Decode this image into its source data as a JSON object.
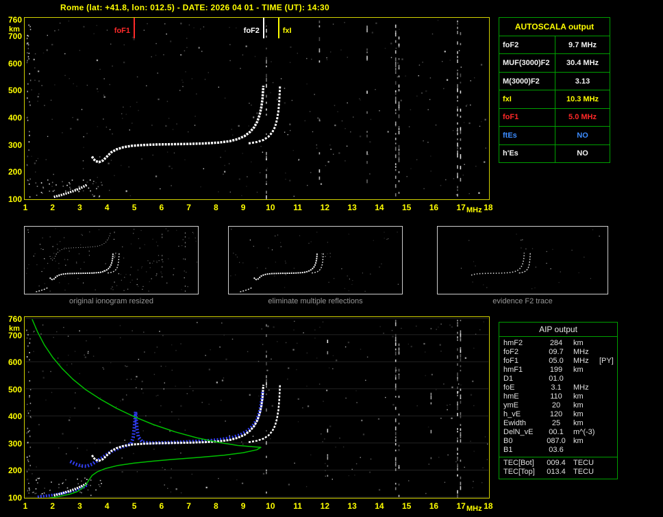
{
  "title": "Rome (lat: +41.8, lon: 012.5) - DATE: 2026 04 01 - TIME (UT): 14:30",
  "autoscala_table": {
    "header": "AUTOSCALA output",
    "rows": [
      {
        "label": "foF2",
        "value": "9.7 MHz",
        "color": "white"
      },
      {
        "label": "MUF(3000)F2",
        "value": "30.4 MHz",
        "color": "white"
      },
      {
        "label": "M(3000)F2",
        "value": "3.13",
        "color": "white"
      },
      {
        "label": "fxI",
        "value": "10.3 MHz",
        "color": "yellow"
      },
      {
        "label": "foF1",
        "value": "5.0 MHz",
        "color": "red"
      },
      {
        "label": "ftEs",
        "value": "NO",
        "color": "blue"
      },
      {
        "label": "h'Es",
        "value": "NO",
        "color": "white"
      }
    ]
  },
  "aip_table": {
    "header": "AIP output",
    "rows": [
      {
        "label": "hmF2",
        "value": "284",
        "unit": "km",
        "note": ""
      },
      {
        "label": "foF2",
        "value": "09.7",
        "unit": "MHz",
        "note": ""
      },
      {
        "label": "foF1",
        "value": "05.0",
        "unit": "MHz",
        "note": "[PY]"
      },
      {
        "label": "hmF1",
        "value": "199",
        "unit": "km",
        "note": ""
      },
      {
        "label": "D1",
        "value": "01.0",
        "unit": "",
        "note": ""
      },
      {
        "label": "foE",
        "value": "3.1",
        "unit": "MHz",
        "note": ""
      },
      {
        "label": "hmE",
        "value": "110",
        "unit": "km",
        "note": ""
      },
      {
        "label": "ymE",
        "value": "20",
        "unit": "km",
        "note": ""
      },
      {
        "label": "h_vE",
        "value": "120",
        "unit": "km",
        "note": ""
      },
      {
        "label": "Ewidth",
        "value": "25",
        "unit": "km",
        "note": ""
      },
      {
        "label": "DelN_vE",
        "value": "00.1",
        "unit": "m^(-3)",
        "note": ""
      },
      {
        "label": "B0",
        "value": "087.0",
        "unit": "km",
        "note": ""
      },
      {
        "label": "B1",
        "value": "03.6",
        "unit": "",
        "note": ""
      }
    ],
    "tec_rows": [
      {
        "label": "TEC[Bot]",
        "value": "009.4",
        "unit": "TECU"
      },
      {
        "label": "TEC[Top]",
        "value": "013.4",
        "unit": "TECU"
      }
    ]
  },
  "thumbnails": [
    {
      "caption": "original ionogram resized"
    },
    {
      "caption": "eliminate multiple reflections"
    },
    {
      "caption": "evidence F2 trace"
    }
  ],
  "chart_data": [
    {
      "type": "scatter",
      "name": "measured ionogram",
      "xlabel": "MHz",
      "ylabel": "km",
      "xlim": [
        1,
        18
      ],
      "ylim": [
        100,
        760
      ],
      "x_ticks": [
        1,
        2,
        3,
        4,
        5,
        6,
        7,
        8,
        9,
        10,
        11,
        12,
        13,
        14,
        15,
        16,
        17,
        18
      ],
      "y_ticks": [
        100,
        200,
        300,
        400,
        500,
        600,
        700,
        760
      ],
      "grid": false,
      "noise_dots": 330,
      "markers": [
        {
          "label": "foF1",
          "f": 5.0,
          "color": "#ff2a2a",
          "side": "left"
        },
        {
          "label": "foF2",
          "f": 9.75,
          "color": "#ffffff",
          "side": "left"
        },
        {
          "label": "fxI",
          "f": 10.3,
          "color": "#ffff00",
          "side": "right"
        }
      ],
      "noise_streaks": [
        {
          "f": 9.85,
          "d": 0.5
        },
        {
          "f": 11.8,
          "d": 0.18
        },
        {
          "f": 13.55,
          "d": 0.18
        },
        {
          "f": 14.6,
          "d": 0.55
        },
        {
          "f": 14.72,
          "d": 0.35
        },
        {
          "f": 16.87,
          "d": 0.6
        },
        {
          "f": 16.98,
          "d": 0.4
        }
      ],
      "series": [
        {
          "name": "Es-E-trace",
          "color": "#ffffff",
          "width": 3.5,
          "dash": "2 1.5",
          "points": [
            [
              2.05,
              106
            ],
            [
              2.2,
              110
            ],
            [
              2.35,
              114
            ],
            [
              2.5,
              119
            ],
            [
              2.65,
              124
            ],
            [
              2.8,
              129
            ],
            [
              2.95,
              135
            ],
            [
              3.1,
              142
            ],
            [
              3.25,
              150
            ]
          ]
        },
        {
          "name": "F-trace-ordinary",
          "color": "#ffffff",
          "width": 3.5,
          "dash": "3 1.5",
          "points": [
            [
              3.45,
              255
            ],
            [
              3.5,
              246
            ],
            [
              3.58,
              238
            ],
            [
              3.7,
              234
            ],
            [
              3.85,
              240
            ],
            [
              4.0,
              255
            ],
            [
              4.15,
              270
            ],
            [
              4.35,
              281
            ],
            [
              4.6,
              289
            ],
            [
              4.9,
              294
            ],
            [
              5.3,
              297
            ],
            [
              5.8,
              299
            ],
            [
              6.4,
              300
            ],
            [
              7.0,
              301
            ],
            [
              7.6,
              303
            ],
            [
              8.1,
              306
            ],
            [
              8.5,
              311
            ],
            [
              8.8,
              319
            ],
            [
              9.05,
              330
            ],
            [
              9.25,
              345
            ],
            [
              9.4,
              362
            ],
            [
              9.52,
              384
            ],
            [
              9.61,
              410
            ],
            [
              9.67,
              438
            ],
            [
              9.71,
              468
            ],
            [
              9.73,
              500
            ],
            [
              9.74,
              515
            ]
          ]
        },
        {
          "name": "F-trace-extraordinary",
          "color": "#ffffff",
          "width": 3,
          "dash": "3 2",
          "points": [
            [
              9.2,
              303
            ],
            [
              9.5,
              308
            ],
            [
              9.75,
              316
            ],
            [
              9.93,
              328
            ],
            [
              10.07,
              344
            ],
            [
              10.17,
              364
            ],
            [
              10.24,
              390
            ],
            [
              10.29,
              420
            ],
            [
              10.32,
              455
            ],
            [
              10.34,
              490
            ],
            [
              10.35,
              515
            ]
          ]
        }
      ]
    },
    {
      "type": "scatter",
      "name": "restored ionogram with electron density profile",
      "xlabel": "MHz",
      "ylabel": "km",
      "xlim": [
        1,
        18
      ],
      "ylim": [
        100,
        760
      ],
      "x_ticks": [
        1,
        2,
        3,
        4,
        5,
        6,
        7,
        8,
        9,
        10,
        11,
        12,
        13,
        14,
        15,
        16,
        17,
        18
      ],
      "y_ticks": [
        100,
        200,
        300,
        400,
        500,
        600,
        700,
        760
      ],
      "grid": true,
      "noise_dots": 300,
      "markers": [],
      "noise_streaks": [
        {
          "f": 9.85,
          "d": 0.3
        },
        {
          "f": 12.1,
          "d": 0.15
        },
        {
          "f": 14.6,
          "d": 0.5
        },
        {
          "f": 14.72,
          "d": 0.3
        },
        {
          "f": 15.9,
          "d": 0.18
        },
        {
          "f": 16.87,
          "d": 0.55
        },
        {
          "f": 16.98,
          "d": 0.45
        }
      ],
      "series": [
        {
          "name": "restored-E-trace",
          "color": "#2f3cf0",
          "width": 4,
          "dash": "2 2",
          "points": [
            [
              1.45,
              101
            ],
            [
              1.7,
              104
            ],
            [
              1.95,
              107
            ],
            [
              2.2,
              111
            ],
            [
              2.45,
              116
            ],
            [
              2.7,
              122
            ],
            [
              2.95,
              129
            ],
            [
              3.15,
              137
            ],
            [
              3.3,
              147
            ]
          ]
        },
        {
          "name": "restored-F-trace",
          "color": "#2f3cf0",
          "width": 5,
          "dash": "2 2.5",
          "points": [
            [
              2.65,
              232
            ],
            [
              2.85,
              222
            ],
            [
              3.05,
              215
            ],
            [
              3.25,
              214
            ],
            [
              3.45,
              222
            ],
            [
              3.6,
              232
            ],
            [
              3.8,
              244
            ],
            [
              4.0,
              258
            ],
            [
              4.2,
              271
            ],
            [
              4.45,
              282
            ],
            [
              4.7,
              290
            ],
            [
              4.88,
              296
            ],
            [
              4.96,
              320
            ],
            [
              5.0,
              355
            ],
            [
              5.03,
              390
            ],
            [
              5.05,
              415
            ],
            [
              5.07,
              388
            ],
            [
              5.1,
              352
            ],
            [
              5.15,
              322
            ],
            [
              5.3,
              303
            ],
            [
              5.6,
              300
            ],
            [
              6.1,
              301
            ],
            [
              6.7,
              303
            ],
            [
              7.3,
              306
            ],
            [
              7.8,
              309
            ],
            [
              8.2,
              313
            ],
            [
              8.6,
              320
            ],
            [
              8.9,
              330
            ],
            [
              9.15,
              344
            ],
            [
              9.35,
              362
            ],
            [
              9.5,
              385
            ],
            [
              9.6,
              412
            ],
            [
              9.66,
              442
            ],
            [
              9.7,
              472
            ],
            [
              9.72,
              495
            ]
          ]
        },
        {
          "name": "Es-E-trace",
          "color": "#ffffff",
          "width": 3.5,
          "dash": "2 1.5",
          "points": [
            [
              2.05,
              106
            ],
            [
              2.2,
              110
            ],
            [
              2.35,
              114
            ],
            [
              2.5,
              119
            ],
            [
              2.65,
              124
            ],
            [
              2.8,
              129
            ],
            [
              2.95,
              135
            ],
            [
              3.1,
              142
            ],
            [
              3.25,
              150
            ]
          ]
        },
        {
          "name": "F-trace-ordinary",
          "color": "#ffffff",
          "width": 3,
          "dash": "3 1.5",
          "points": [
            [
              3.45,
              255
            ],
            [
              3.5,
              246
            ],
            [
              3.58,
              238
            ],
            [
              3.7,
              234
            ],
            [
              3.85,
              240
            ],
            [
              4.0,
              255
            ],
            [
              4.15,
              270
            ],
            [
              4.35,
              281
            ],
            [
              4.6,
              289
            ],
            [
              4.9,
              294
            ],
            [
              5.3,
              297
            ],
            [
              5.8,
              299
            ],
            [
              6.4,
              300
            ],
            [
              7.0,
              301
            ],
            [
              7.6,
              303
            ],
            [
              8.1,
              306
            ],
            [
              8.5,
              311
            ],
            [
              8.8,
              319
            ],
            [
              9.05,
              330
            ],
            [
              9.25,
              345
            ],
            [
              9.4,
              362
            ],
            [
              9.52,
              384
            ],
            [
              9.61,
              410
            ],
            [
              9.67,
              438
            ],
            [
              9.71,
              468
            ],
            [
              9.73,
              500
            ],
            [
              9.74,
              515
            ]
          ]
        },
        {
          "name": "F-trace-extraordinary",
          "color": "#ffffff",
          "width": 2.5,
          "dash": "3 2",
          "points": [
            [
              9.2,
              303
            ],
            [
              9.5,
              308
            ],
            [
              9.75,
              316
            ],
            [
              9.93,
              328
            ],
            [
              10.07,
              344
            ],
            [
              10.17,
              364
            ],
            [
              10.24,
              390
            ],
            [
              10.29,
              420
            ],
            [
              10.32,
              455
            ],
            [
              10.34,
              490
            ],
            [
              10.35,
              515
            ]
          ]
        },
        {
          "name": "electron-density-profile",
          "color": "#00c000",
          "width": 1.5,
          "dash": "",
          "points": [
            [
              1.25,
              757
            ],
            [
              1.45,
              710
            ],
            [
              1.7,
              662
            ],
            [
              2.0,
              617
            ],
            [
              2.35,
              575
            ],
            [
              2.75,
              535
            ],
            [
              3.2,
              498
            ],
            [
              3.75,
              462
            ],
            [
              4.35,
              428
            ],
            [
              5.0,
              397
            ],
            [
              5.7,
              368
            ],
            [
              6.5,
              341
            ],
            [
              7.3,
              319
            ],
            [
              8.1,
              302
            ],
            [
              8.8,
              291
            ],
            [
              9.35,
              286
            ],
            [
              9.65,
              284
            ],
            [
              9.5,
              275
            ],
            [
              9.0,
              264
            ],
            [
              8.3,
              255
            ],
            [
              7.4,
              247
            ],
            [
              6.5,
              240
            ],
            [
              5.7,
              233
            ],
            [
              5.0,
              226
            ],
            [
              4.4,
              217
            ],
            [
              3.95,
              206
            ],
            [
              3.65,
              194
            ],
            [
              3.45,
              180
            ],
            [
              3.35,
              165
            ],
            [
              3.25,
              150
            ],
            [
              3.1,
              133
            ],
            [
              2.9,
              120
            ],
            [
              2.6,
              110
            ],
            [
              2.2,
              102
            ],
            [
              1.85,
              96
            ]
          ]
        }
      ]
    }
  ]
}
